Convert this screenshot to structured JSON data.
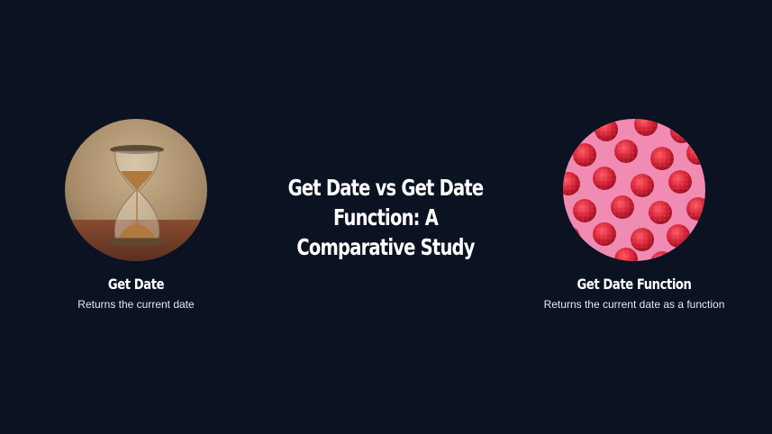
{
  "title": "Get Date vs Get Date Function: A Comparative Study",
  "cards": [
    {
      "image_icon": "hourglass-photo",
      "title": "Get Date",
      "description": "Returns the current date"
    },
    {
      "image_icon": "raspberries-photo",
      "title": "Get Date Function",
      "description": "Returns the current date as a function"
    }
  ],
  "colors": {
    "background": "#0b1221",
    "text": "#ffffff"
  }
}
